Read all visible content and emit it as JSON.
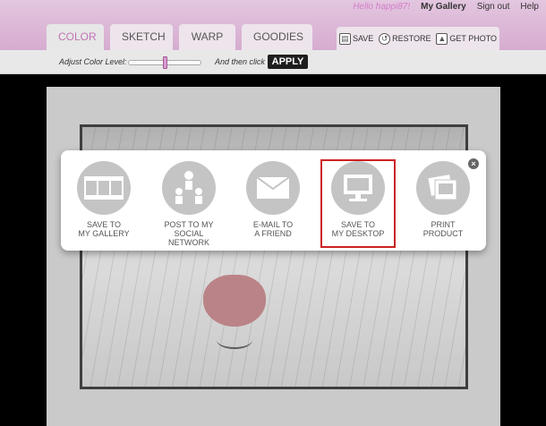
{
  "header": {
    "greeting": "Hello happi87!",
    "links": [
      "My Gallery",
      "Sign out",
      "Help"
    ]
  },
  "tabs": [
    {
      "label": "COLOR",
      "active": true
    },
    {
      "label": "SKETCH",
      "active": false
    },
    {
      "label": "WARP",
      "active": false
    },
    {
      "label": "GOODIES",
      "active": false
    }
  ],
  "actions": [
    {
      "label": "SAVE",
      "icon": "floppy-icon"
    },
    {
      "label": "RESTORE",
      "icon": "restore-icon"
    },
    {
      "label": "GET PHOTO",
      "icon": "get-photo-icon"
    }
  ],
  "toolbar": {
    "adjust_label": "Adjust Color Level:",
    "then_label": "And then click",
    "apply_label": "APPLY",
    "slider_value": 0.5
  },
  "share": {
    "options": [
      {
        "line1": "SAVE TO",
        "line2": "MY GALLERY",
        "icon": "film-strip-icon"
      },
      {
        "line1": "POST TO MY",
        "line2": "SOCIAL NETWORK",
        "icon": "people-network-icon"
      },
      {
        "line1": "E-MAIL TO",
        "line2": "A FRIEND",
        "icon": "envelope-icon"
      },
      {
        "line1": "SAVE TO",
        "line2": "MY DESKTOP",
        "icon": "monitor-icon",
        "highlighted": true
      },
      {
        "line1": "PRINT",
        "line2": "PRODUCT",
        "icon": "print-product-icon"
      }
    ],
    "highlight_color": "#cc2222"
  },
  "colors": {
    "header_pink": "#d6acd0",
    "accent_pink": "#c074b5"
  }
}
